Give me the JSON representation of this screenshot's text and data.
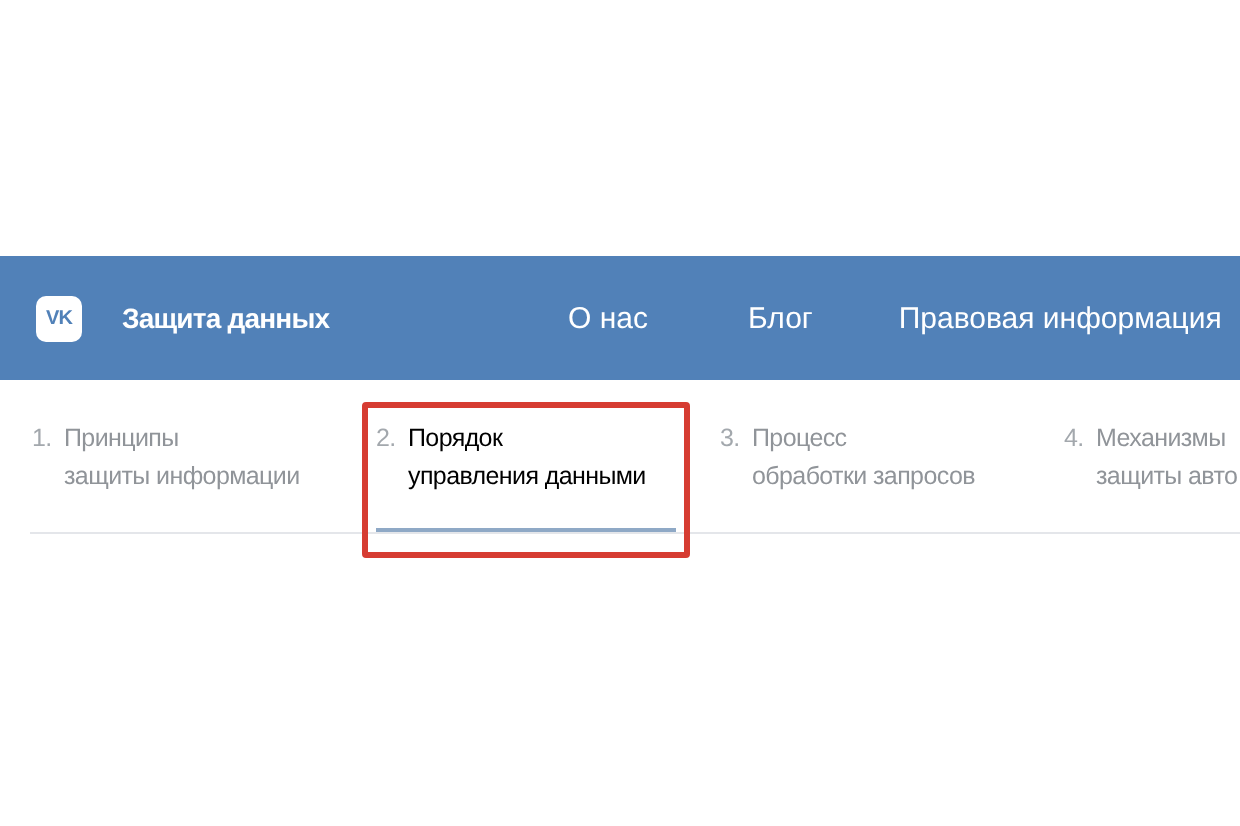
{
  "header": {
    "logo": "VK",
    "title": "Защита данных",
    "nav": [
      {
        "label": "О нас"
      },
      {
        "label": "Блог"
      },
      {
        "label": "Правовая информация"
      }
    ]
  },
  "steps": [
    {
      "number": "1.",
      "lines": [
        "Принципы",
        "защиты информации"
      ],
      "selected": false,
      "highlighted": false
    },
    {
      "number": "2.",
      "lines": [
        "Порядок",
        "управления данными"
      ],
      "selected": true,
      "highlighted": true
    },
    {
      "number": "3.",
      "lines": [
        "Процесс",
        "обработки запросов"
      ],
      "selected": false,
      "highlighted": false
    },
    {
      "number": "4.",
      "lines": [
        "Механизмы",
        "защиты авто"
      ],
      "selected": false,
      "highlighted": false
    }
  ]
}
